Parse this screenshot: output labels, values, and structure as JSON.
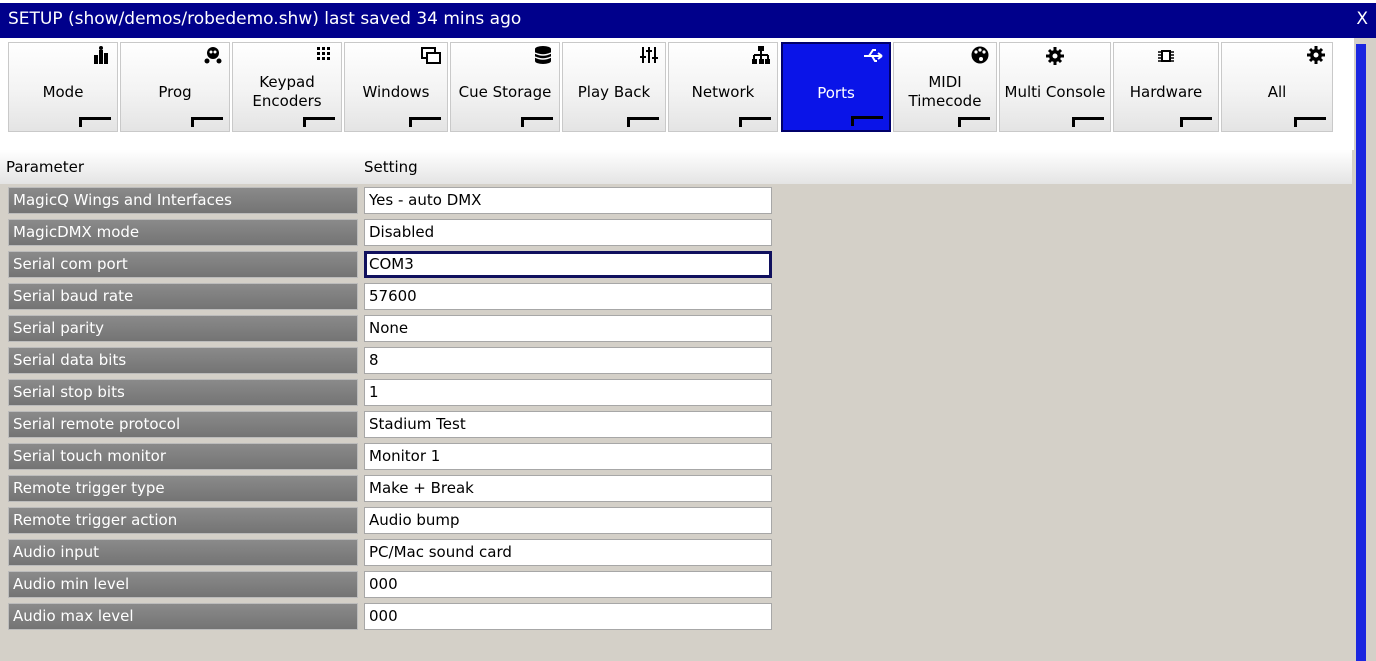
{
  "window": {
    "title": "SETUP (show/demos/robedemo.shw) last saved 34 mins ago",
    "close_label": "X",
    "accent_color": "#00008b",
    "active_tab_color": "#0a14e8"
  },
  "tabs": [
    {
      "label": "Mode",
      "icon": "mode-icon",
      "active": false
    },
    {
      "label": "Prog",
      "icon": "prog-icon",
      "active": false
    },
    {
      "label": "Keypad Encoders",
      "icon": "keypad-icon",
      "active": false
    },
    {
      "label": "Windows",
      "icon": "windows-icon",
      "active": false
    },
    {
      "label": "Cue Storage",
      "icon": "database-icon",
      "active": false
    },
    {
      "label": "Play Back",
      "icon": "sliders-icon",
      "active": false
    },
    {
      "label": "Network",
      "icon": "network-icon",
      "active": false
    },
    {
      "label": "Ports",
      "icon": "usb-icon",
      "active": true
    },
    {
      "label": "MIDI Timecode",
      "icon": "palette-icon",
      "active": false
    },
    {
      "label": "Multi Console",
      "icon": "gear-icon",
      "active": false
    },
    {
      "label": "Hardware",
      "icon": "chip-icon",
      "active": false
    },
    {
      "label": "All",
      "icon": "gear-icon",
      "active": false
    }
  ],
  "table": {
    "headers": {
      "parameter": "Parameter",
      "setting": "Setting"
    },
    "rows": [
      {
        "parameter": "MagicQ Wings and Interfaces",
        "setting": "Yes - auto DMX"
      },
      {
        "parameter": "MagicDMX mode",
        "setting": "Disabled"
      },
      {
        "parameter": "Serial com port",
        "setting": "COM3",
        "selected": true
      },
      {
        "parameter": "Serial baud rate",
        "setting": "57600"
      },
      {
        "parameter": "Serial parity",
        "setting": "None"
      },
      {
        "parameter": "Serial data bits",
        "setting": "8"
      },
      {
        "parameter": "Serial stop bits",
        "setting": "1"
      },
      {
        "parameter": "Serial remote protocol",
        "setting": "Stadium Test"
      },
      {
        "parameter": "Serial touch monitor",
        "setting": "Monitor 1"
      },
      {
        "parameter": "Remote trigger type",
        "setting": "Make + Break"
      },
      {
        "parameter": "Remote trigger action",
        "setting": "Audio bump"
      },
      {
        "parameter": "Audio input",
        "setting": "PC/Mac sound card"
      },
      {
        "parameter": "Audio min level",
        "setting": "000"
      },
      {
        "parameter": "Audio max level",
        "setting": "000"
      }
    ]
  }
}
